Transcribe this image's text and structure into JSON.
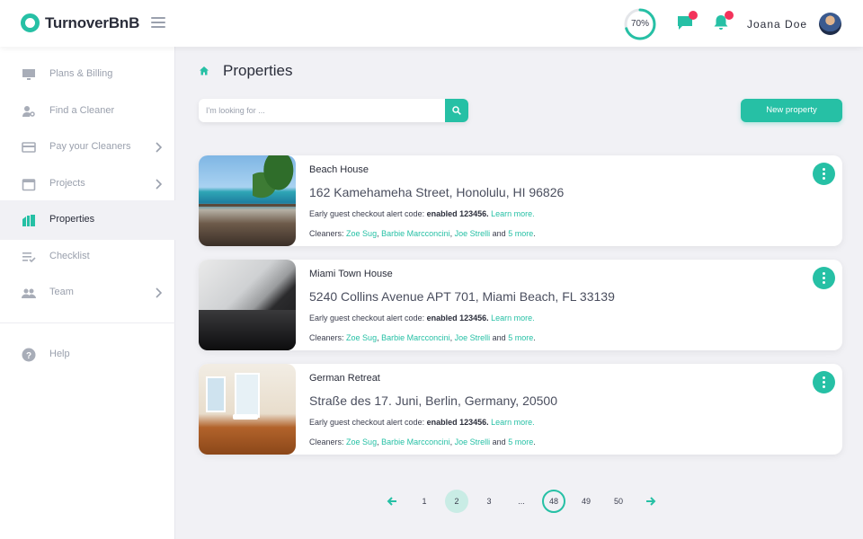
{
  "app": {
    "name": "TurnoverBnB"
  },
  "header": {
    "progress_label": "70%",
    "progress_value": 0.7,
    "user_name": "Joana Doe",
    "accent": "#26c0a5",
    "notif_color": "#f3335b"
  },
  "sidebar": {
    "items": [
      {
        "label": "Plans & Billing",
        "icon": "monitor-icon"
      },
      {
        "label": "Find a Cleaner",
        "icon": "user-search-icon"
      },
      {
        "label": "Pay your Cleaners",
        "icon": "credit-card-icon"
      },
      {
        "label": "Projects",
        "icon": "calendar-icon"
      },
      {
        "label": "Properties",
        "icon": "building-icon",
        "active": true
      },
      {
        "label": "Checklist",
        "icon": "checklist-icon"
      },
      {
        "label": "Team",
        "icon": "team-icon"
      }
    ],
    "help_label": "Help"
  },
  "main": {
    "title": "Properties",
    "search_placeholder": "I'm looking for ...",
    "new_property_label": "New property"
  },
  "properties": [
    {
      "name": "Beach House",
      "address": "162 Kamehameha Street, Honolulu, HI 96826",
      "alert_prefix": "Early guest checkout alert code:",
      "alert_status": "enabled 123456.",
      "learn_more": "Learn more.",
      "cleaners_prefix": "Cleaners:",
      "cleaners": [
        "Zoe Sug",
        "Barbie Marcconcini",
        "Joe Strelli"
      ],
      "and_text": "and",
      "more_text": "5 more"
    },
    {
      "name": "Miami Town House",
      "address": "5240 Collins Avenue APT 701, Miami Beach, FL 33139",
      "alert_prefix": "Early guest checkout alert code:",
      "alert_status": "enabled 123456.",
      "learn_more": "Learn more.",
      "cleaners_prefix": "Cleaners:",
      "cleaners": [
        "Zoe Sug",
        "Barbie Marcconcini",
        "Joe Strelli"
      ],
      "and_text": "and",
      "more_text": "5 more"
    },
    {
      "name": "German Retreat",
      "address": "Straße des 17. Juni, Berlin, Germany, 20500",
      "alert_prefix": "Early guest checkout alert code:",
      "alert_status": "enabled 123456.",
      "learn_more": "Learn more.",
      "cleaners_prefix": "Cleaners:",
      "cleaners": [
        "Zoe Sug",
        "Barbie Marcconcini",
        "Joe Strelli"
      ],
      "and_text": "and",
      "more_text": "5 more"
    }
  ],
  "pagination": {
    "pages": [
      "1",
      "2",
      "3",
      "...",
      "48",
      "49",
      "50"
    ],
    "current": "2",
    "highlighted": "48"
  }
}
